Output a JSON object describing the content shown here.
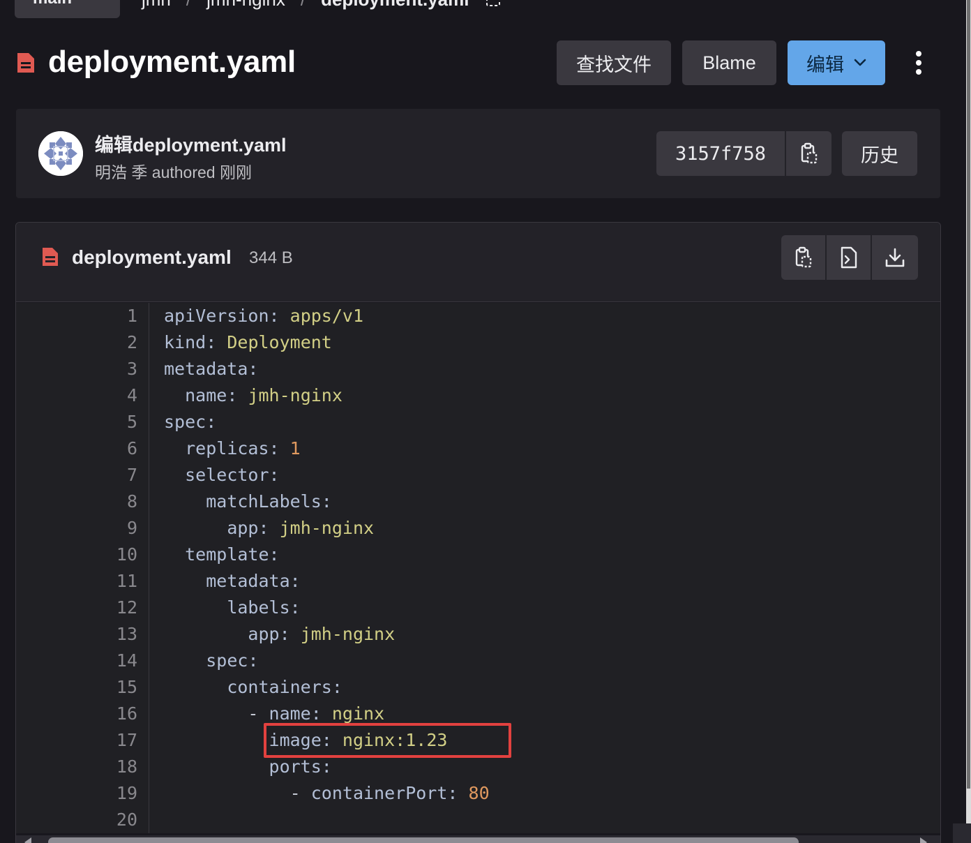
{
  "breadcrumb": {
    "branch": "main",
    "items": [
      "jmh",
      "jmh-nginx",
      "deployment.yaml"
    ],
    "separator": "/"
  },
  "header": {
    "title": "deployment.yaml",
    "find_file_label": "查找文件",
    "blame_label": "Blame",
    "edit_label": "编辑"
  },
  "commit": {
    "message": "编辑deployment.yaml",
    "author": "明浩 季",
    "authored_text": "authored",
    "time": "刚刚",
    "sha": "3157f758",
    "history_label": "历史"
  },
  "file": {
    "name": "deployment.yaml",
    "size": "344 B"
  },
  "code": {
    "line_numbers": [
      "1",
      "2",
      "3",
      "4",
      "5",
      "6",
      "7",
      "8",
      "9",
      "10",
      "11",
      "12",
      "13",
      "14",
      "15",
      "16",
      "17",
      "18",
      "19",
      "20"
    ],
    "lines": [
      {
        "indent": "",
        "dash": "",
        "key": "apiVersion",
        "value": "apps/v1",
        "type": "str"
      },
      {
        "indent": "",
        "dash": "",
        "key": "kind",
        "value": "Deployment",
        "type": "str"
      },
      {
        "indent": "",
        "dash": "",
        "key": "metadata",
        "value": "",
        "type": "str"
      },
      {
        "indent": "  ",
        "dash": "",
        "key": "name",
        "value": "jmh-nginx",
        "type": "str"
      },
      {
        "indent": "",
        "dash": "",
        "key": "spec",
        "value": "",
        "type": "str"
      },
      {
        "indent": "  ",
        "dash": "",
        "key": "replicas",
        "value": "1",
        "type": "num"
      },
      {
        "indent": "  ",
        "dash": "",
        "key": "selector",
        "value": "",
        "type": "str"
      },
      {
        "indent": "    ",
        "dash": "",
        "key": "matchLabels",
        "value": "",
        "type": "str"
      },
      {
        "indent": "      ",
        "dash": "",
        "key": "app",
        "value": "jmh-nginx",
        "type": "str"
      },
      {
        "indent": "  ",
        "dash": "",
        "key": "template",
        "value": "",
        "type": "str"
      },
      {
        "indent": "    ",
        "dash": "",
        "key": "metadata",
        "value": "",
        "type": "str"
      },
      {
        "indent": "      ",
        "dash": "",
        "key": "labels",
        "value": "",
        "type": "str"
      },
      {
        "indent": "        ",
        "dash": "",
        "key": "app",
        "value": "jmh-nginx",
        "type": "str"
      },
      {
        "indent": "    ",
        "dash": "",
        "key": "spec",
        "value": "",
        "type": "str"
      },
      {
        "indent": "      ",
        "dash": "",
        "key": "containers",
        "value": "",
        "type": "str"
      },
      {
        "indent": "        ",
        "dash": "- ",
        "key": "name",
        "value": "nginx",
        "type": "str"
      },
      {
        "indent": "          ",
        "dash": "",
        "key": "image",
        "value": "nginx:1.23",
        "type": "str"
      },
      {
        "indent": "          ",
        "dash": "",
        "key": "ports",
        "value": "",
        "type": "str"
      },
      {
        "indent": "            ",
        "dash": "- ",
        "key": "containerPort",
        "value": "80",
        "type": "num"
      },
      {
        "indent": "",
        "dash": "",
        "key": "",
        "value": "",
        "type": "str"
      }
    ],
    "highlighted_line": "17"
  },
  "colors": {
    "background": "#18171d",
    "edit_button": "#63a6e9",
    "highlight_border": "#e2413f",
    "file_icon": "#e05a52",
    "yaml_key": "#b3bfd6",
    "yaml_string": "#d2cf86",
    "yaml_number": "#e0995f"
  }
}
